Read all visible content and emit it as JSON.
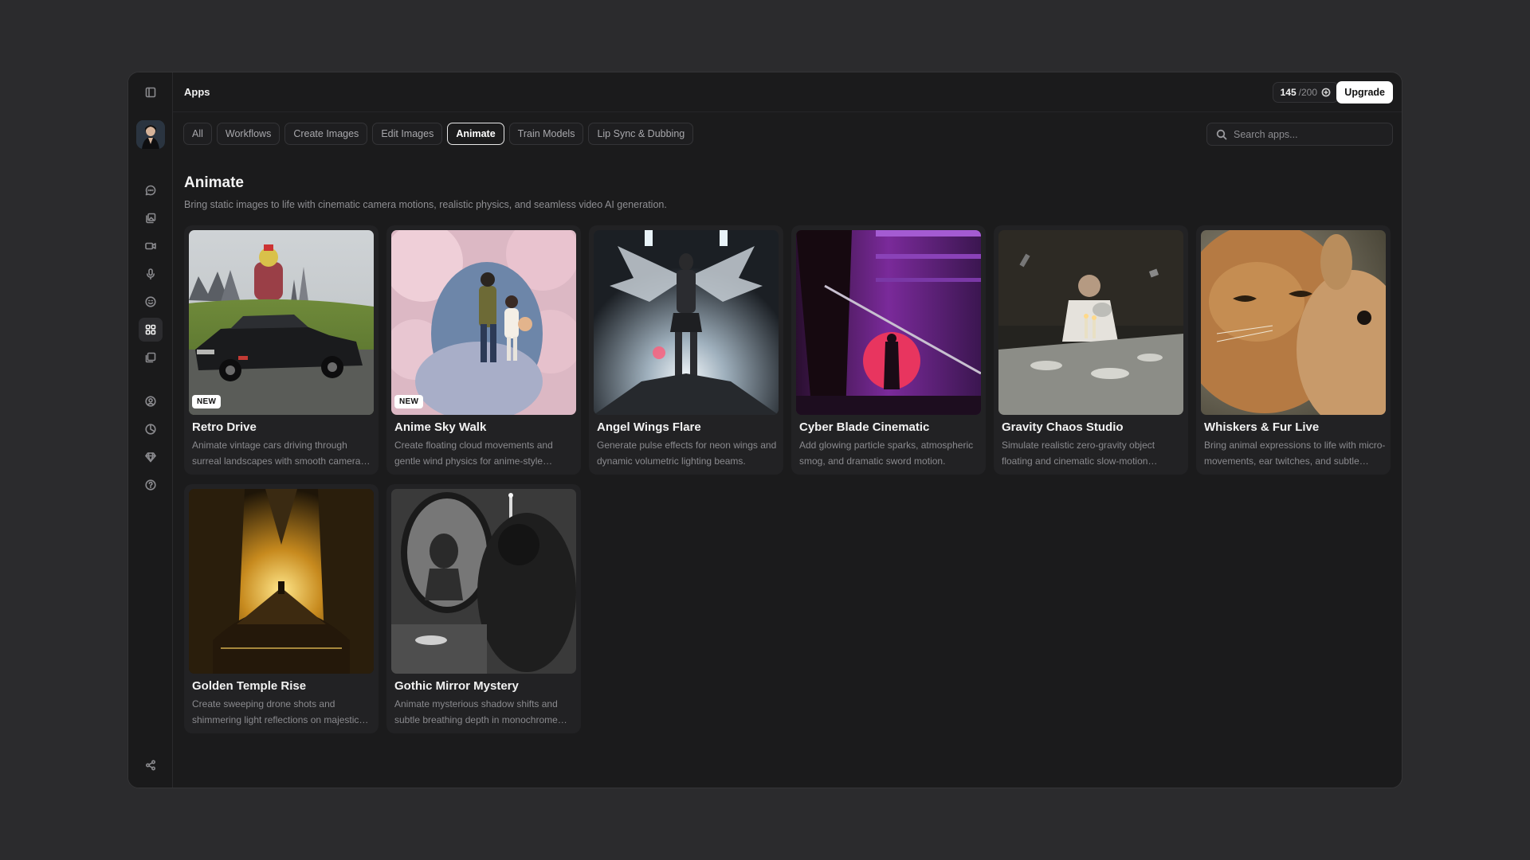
{
  "topbar": {
    "title": "Apps",
    "credits_used": "145",
    "credits_total": "/200",
    "upgrade_label": "Upgrade"
  },
  "tabs": [
    {
      "label": "All",
      "active": false
    },
    {
      "label": "Workflows",
      "active": false
    },
    {
      "label": "Create Images",
      "active": false
    },
    {
      "label": "Edit Images",
      "active": false
    },
    {
      "label": "Animate",
      "active": true
    },
    {
      "label": "Train Models",
      "active": false
    },
    {
      "label": "Lip Sync & Dubbing",
      "active": false
    }
  ],
  "search": {
    "placeholder": "Search apps..."
  },
  "section": {
    "title": "Animate",
    "description": "Bring static images to life with cinematic camera motions, realistic physics, and seamless video AI generation."
  },
  "sidebar": {
    "icons": [
      "panel-toggle-icon",
      "chat-icon",
      "images-icon",
      "video-icon",
      "microphone-icon",
      "face-icon",
      "apps-grid-icon",
      "gallery-icon",
      "user-icon",
      "history-icon",
      "diamond-icon",
      "help-icon",
      "share-icon"
    ],
    "active": "apps-grid-icon"
  },
  "cards": [
    {
      "title": "Retro Drive",
      "desc": "Animate vintage cars driving through surreal landscapes with smooth camera movements.",
      "badge": "NEW"
    },
    {
      "title": "Anime Sky Walk",
      "desc": "Create floating cloud movements and gentle wind physics for anime-style characters.",
      "badge": "NEW"
    },
    {
      "title": "Angel Wings Flare",
      "desc": "Generate pulse effects for neon wings and dynamic volumetric lighting beams.",
      "badge": ""
    },
    {
      "title": "Cyber Blade Cinematic",
      "desc": "Add glowing particle sparks, atmospheric smog, and dramatic sword motion.",
      "badge": ""
    },
    {
      "title": "Gravity Chaos Studio",
      "desc": "Simulate realistic zero-gravity object floating and cinematic slow-motion physics.",
      "badge": ""
    },
    {
      "title": "Whiskers & Fur Live",
      "desc": "Bring animal expressions to life with micro-movements, ear twitches, and subtle breathing.",
      "badge": ""
    },
    {
      "title": "Golden Temple Rise",
      "desc": "Create sweeping drone shots and shimmering light reflections on majestic architecture.",
      "badge": ""
    },
    {
      "title": "Gothic Mirror Mystery",
      "desc": "Animate mysterious shadow shifts and subtle breathing depth in monochrome portraits.",
      "badge": ""
    }
  ]
}
